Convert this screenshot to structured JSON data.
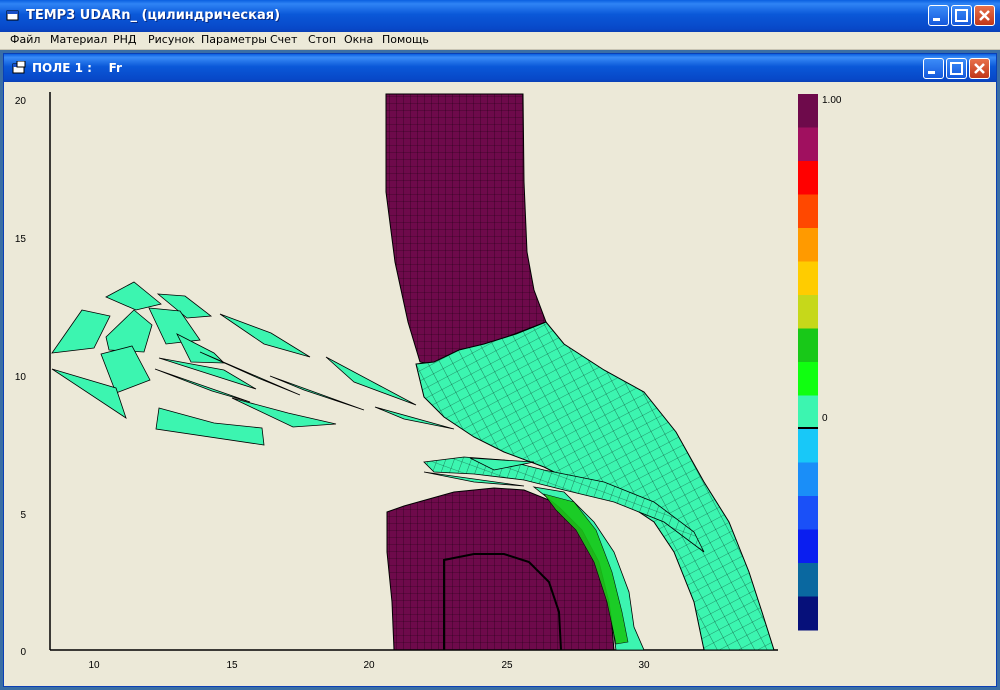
{
  "window": {
    "title": "TEMP3  UDARn_ (цилиндрическая)",
    "icon": "app-window-icon"
  },
  "menu": [
    "Файл",
    "Материал",
    "РНД",
    "Рисунок",
    "Параметры",
    "Счет",
    "Стоп",
    "Окна",
    "Помощь"
  ],
  "child_window": {
    "title": "ПОЛЕ 1 :    Fr",
    "icon": "field-window-icon"
  },
  "plot": {
    "x_ticks": [
      "10",
      "15",
      "20",
      "25",
      "30"
    ],
    "y_ticks": [
      "0",
      "5",
      "10",
      "15",
      "20"
    ],
    "xlim": [
      8.5,
      35
    ],
    "ylim": [
      0,
      20.3
    ]
  },
  "colorbar": {
    "max_label": "1.00",
    "zero_label": "0",
    "colors": [
      "#6e0a4b",
      "#a0105f",
      "#ff0000",
      "#ff4800",
      "#ff9a00",
      "#ffcc00",
      "#c6d81a",
      "#18c818",
      "#10ff10",
      "#3cf5b0",
      "#18c8f8",
      "#1a8ef8",
      "#1a50f8",
      "#0a1ef0",
      "#0a68a0",
      "#06107a"
    ]
  },
  "colors": {
    "material_purple": "#6e0a4b",
    "material_green": "#3cf5b0",
    "material_bright_green": "#18c818"
  }
}
